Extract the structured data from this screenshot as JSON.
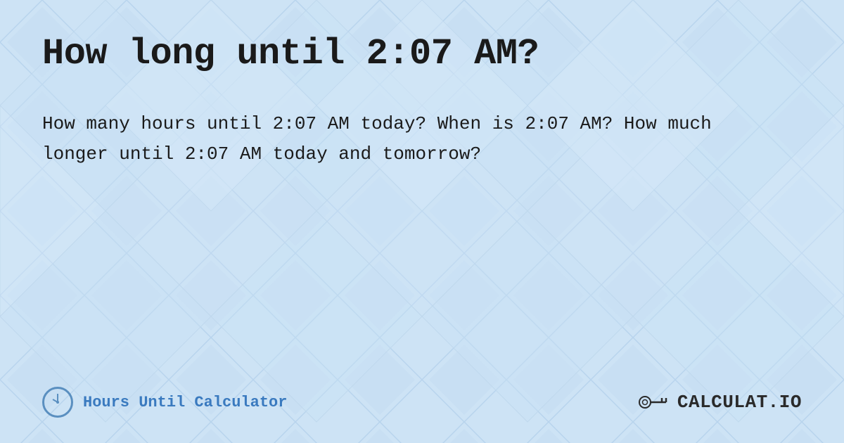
{
  "page": {
    "title": "How long until 2:07 AM?",
    "description": "How many hours until 2:07 AM today? When is 2:07 AM? How much longer until 2:07 AM today and tomorrow?",
    "background_color": "#cde3f5"
  },
  "footer": {
    "label": "Hours Until Calculator",
    "logo_text": "CALCULAT.IO",
    "clock_icon_name": "clock-icon",
    "logo_icon_name": "calculator-logo-icon"
  }
}
